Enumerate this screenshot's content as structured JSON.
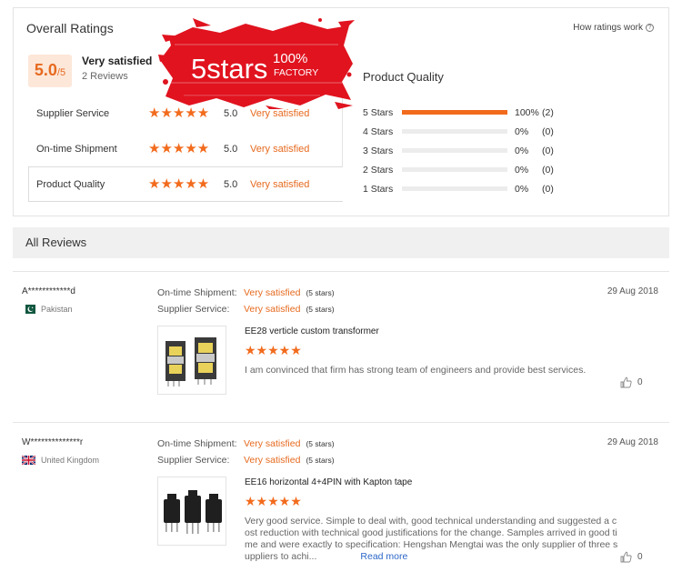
{
  "ratings": {
    "title": "Overall Ratings",
    "how_link": "How ratings work",
    "score": "5.0",
    "score_out_of": "/5",
    "summary_label": "Very satisfied",
    "review_count": "2 Reviews",
    "services": [
      {
        "name": "Supplier Service",
        "score": "5.0",
        "desc": "Very satisfied"
      },
      {
        "name": "On-time Shipment",
        "score": "5.0",
        "desc": "Very satisfied"
      },
      {
        "name": "Product Quality",
        "score": "5.0",
        "desc": "Very satisfied"
      }
    ],
    "product_quality_title": "Product Quality",
    "distribution": [
      {
        "label": "5 Stars",
        "fraction": 1.0,
        "percent": "100%",
        "count": "(2)"
      },
      {
        "label": "4 Stars",
        "fraction": 0,
        "percent": "0%",
        "count": "(0)"
      },
      {
        "label": "3 Stars",
        "fraction": 0,
        "percent": "0%",
        "count": "(0)"
      },
      {
        "label": "2 Stars",
        "fraction": 0,
        "percent": "0%",
        "count": "(0)"
      },
      {
        "label": "1 Stars",
        "fraction": 0,
        "percent": "0%",
        "count": "(0)"
      }
    ]
  },
  "stamp": {
    "big": "5stars",
    "small_top": "100%",
    "small_bottom": "FACTORY"
  },
  "all_reviews_title": "All Reviews",
  "reviews": [
    {
      "user": "A************d",
      "country": "Pakistan",
      "date": "29 Aug 2018",
      "shipment_label": "On-time Shipment:",
      "shipment_value": "Very satisfied",
      "shipment_stars": "(5 stars)",
      "service_label": "Supplier Service:",
      "service_value": "Very satisfied",
      "service_stars": "(5 stars)",
      "product": "EE28 verticle custom transformer",
      "text": "I am convinced that firm has strong team of engineers and provide best services.",
      "likes": "0"
    },
    {
      "user": "W**************r",
      "country": "United Kingdom",
      "date": "29 Aug 2018",
      "shipment_label": "On-time Shipment:",
      "shipment_value": "Very satisfied",
      "shipment_stars": "(5 stars)",
      "service_label": "Supplier Service:",
      "service_value": "Very satisfied",
      "service_stars": "(5 stars)",
      "product": "EE16 horizontal 4+4PIN with Kapton tape",
      "text": "Very good service. Simple to deal with, good technical understanding and suggested a cost reduction with technical good justifications for the change. Samples arrived in good time and were exactly to specification: Hengshan Mengtai was the only supplier of three suppliers to achi...",
      "read_more": "Read more",
      "likes": "0"
    }
  ],
  "colors": {
    "accent": "#f26b1d",
    "accent_text": "#e66a1f",
    "stamp_red": "#e0131f"
  }
}
